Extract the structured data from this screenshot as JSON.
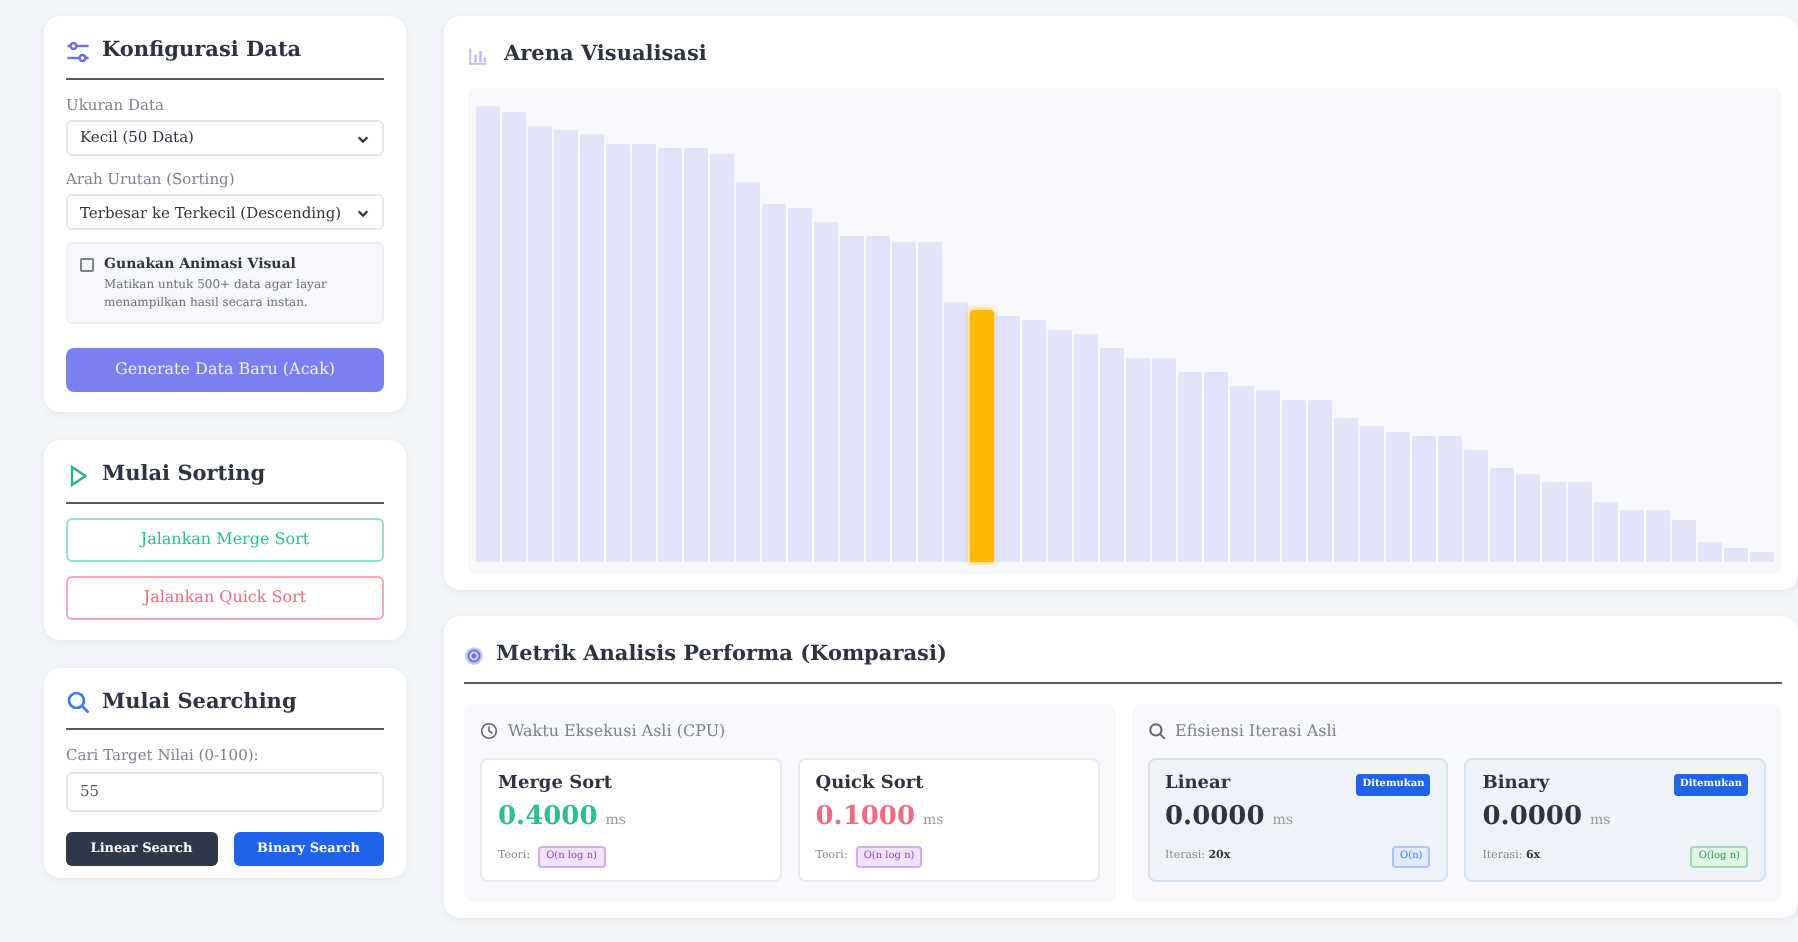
{
  "config": {
    "title": "Konfigurasi Data",
    "fields": [
      {
        "label": "Ukuran Data",
        "value": "Kecil (50 Data)"
      },
      {
        "label": "Arah Urutan (Sorting)",
        "value": "Terbesar ke Terkecil (Descending)"
      }
    ],
    "checkbox": {
      "label": "Gunakan Animasi Visual",
      "description": "Matikan untuk 500+ data agar layar menampilkan hasil secara instan.",
      "checked": false
    },
    "button": "Generate Data Baru (Acak)"
  },
  "sorting": {
    "title": "Mulai Sorting",
    "buttons": [
      {
        "label": "Jalankan Merge Sort",
        "kind": "merge"
      },
      {
        "label": "Jalankan Quick Sort",
        "kind": "quick"
      }
    ]
  },
  "searching": {
    "title": "Mulai Searching",
    "input_label": "Cari Target Nilai (0-100):",
    "input_value": "55",
    "buttons": [
      {
        "label": "Linear Search",
        "kind": "linear"
      },
      {
        "label": "Binary Search",
        "kind": "binary"
      }
    ]
  },
  "arena": {
    "title": "Arena Visualisasi",
    "bars": [
      {
        "highlighted": false
      },
      {
        "highlighted": false
      },
      {
        "highlighted": false
      },
      {
        "highlighted": false
      },
      {
        "highlighted": false
      },
      {
        "highlighted": false
      },
      {
        "highlighted": false
      },
      {
        "highlighted": false
      },
      {
        "highlighted": false
      },
      {
        "highlighted": false
      },
      {
        "highlighted": false
      },
      {
        "highlighted": false
      },
      {
        "highlighted": false
      },
      {
        "highlighted": false
      },
      {
        "highlighted": false
      },
      {
        "highlighted": false
      },
      {
        "highlighted": false
      },
      {
        "highlighted": false
      },
      {
        "highlighted": false
      },
      {
        "highlighted": true
      },
      {
        "highlighted": false
      },
      {
        "highlighted": false
      },
      {
        "highlighted": false
      },
      {
        "highlighted": false
      },
      {
        "highlighted": false
      },
      {
        "highlighted": false
      },
      {
        "highlighted": false
      },
      {
        "highlighted": false
      },
      {
        "highlighted": false
      },
      {
        "highlighted": false
      },
      {
        "highlighted": false
      },
      {
        "highlighted": false
      },
      {
        "highlighted": false
      },
      {
        "highlighted": false
      },
      {
        "highlighted": false
      },
      {
        "highlighted": false
      },
      {
        "highlighted": false
      },
      {
        "highlighted": false
      },
      {
        "highlighted": false
      },
      {
        "highlighted": false
      },
      {
        "highlighted": false
      },
      {
        "highlighted": false
      },
      {
        "highlighted": false
      },
      {
        "highlighted": false
      },
      {
        "highlighted": false
      },
      {
        "highlighted": false
      },
      {
        "highlighted": false
      },
      {
        "highlighted": false
      },
      {
        "highlighted": false
      },
      {
        "highlighted": false
      }
    ]
  },
  "metrics": {
    "title": "Metrik Analisis Performa (Komparasi)",
    "groups": [
      {
        "title": "Waktu Eksekusi Asli (CPU)",
        "kind": "clock",
        "cards": [
          {
            "kind": "merge",
            "name": "Merge Sort",
            "value": "0.4000",
            "unit": "ms",
            "footer_label": "Teori:",
            "tag": "O(n log n)"
          },
          {
            "kind": "quick",
            "name": "Quick Sort",
            "value": "0.1000",
            "unit": "ms",
            "footer_label": "Teori:",
            "tag": "O(n log n)"
          }
        ]
      },
      {
        "title": "Efisiensi Iterasi Asli",
        "kind": "search",
        "cards": [
          {
            "kind": "linear",
            "name": "Linear",
            "status": "Ditemukan",
            "value": "0.0000",
            "unit": "ms",
            "footer_label": "Iterasi:",
            "footer_value": "20x",
            "tag": "O(n)"
          },
          {
            "kind": "binary",
            "name": "Binary",
            "status": "Ditemukan",
            "value": "0.0000",
            "unit": "ms",
            "footer_label": "Iterasi:",
            "footer_value": "6x",
            "tag": "O(log n)"
          }
        ]
      }
    ]
  }
}
